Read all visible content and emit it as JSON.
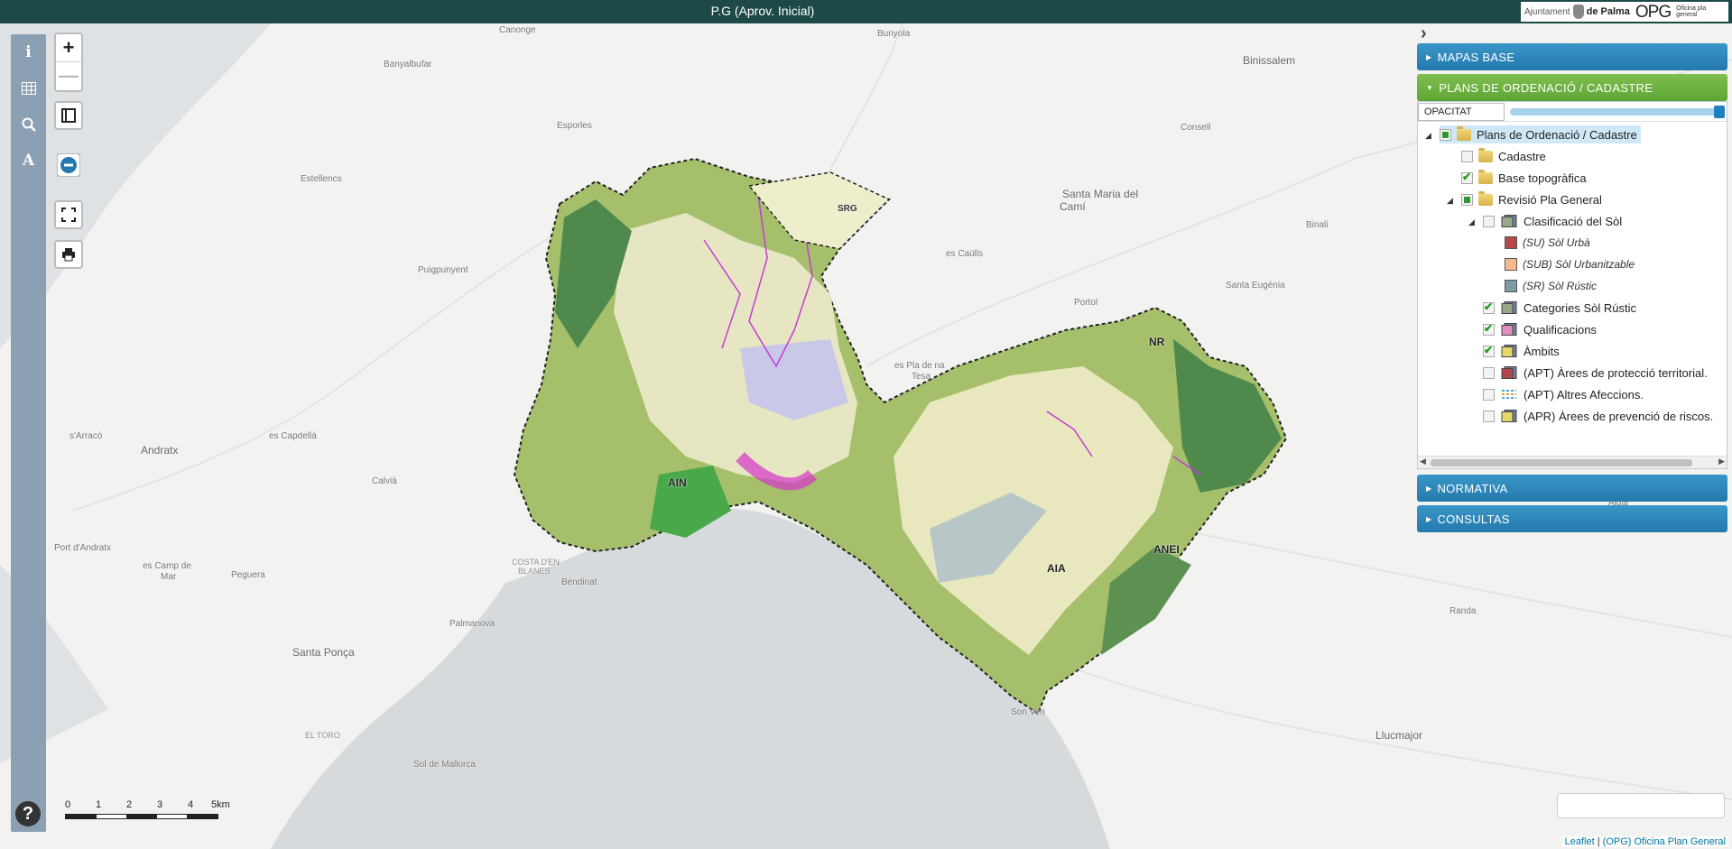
{
  "app": {
    "title": "P.G (Aprov. Inicial)"
  },
  "logos": {
    "ajuntament_prefix": "Ajuntament",
    "ajuntament_name": "de Palma",
    "opg": "OPG",
    "opg_sub": "Oficina pla general"
  },
  "rail": {
    "info_icon": "i",
    "table_icon": "table-icon",
    "search_icon": "search-icon",
    "text_icon": "A",
    "help_icon": "?"
  },
  "map_controls": {
    "zoom_in": "+",
    "zoom_out": "—"
  },
  "scale": {
    "labels": [
      "0",
      "1",
      "2",
      "3",
      "4",
      "5km"
    ]
  },
  "attribution": {
    "leaflet": "Leaflet",
    "separator": " | ",
    "opg": "(OPG) Oficina Plan General"
  },
  "places": [
    {
      "name": "Canonge",
      "cls": ""
    },
    {
      "name": "Bunyola",
      "cls": ""
    },
    {
      "name": "Banyalbufar",
      "cls": ""
    },
    {
      "name": "Binissalem",
      "cls": "big"
    },
    {
      "name": "Esporles",
      "cls": ""
    },
    {
      "name": "Consell",
      "cls": ""
    },
    {
      "name": "Estellencs",
      "cls": ""
    },
    {
      "name": "Santa Maria del",
      "cls": "big"
    },
    {
      "name": "Camí",
      "cls": "big"
    },
    {
      "name": "Binali",
      "cls": ""
    },
    {
      "name": "Puigpunyent",
      "cls": ""
    },
    {
      "name": "es Caülls",
      "cls": ""
    },
    {
      "name": "Santa Eugènia",
      "cls": ""
    },
    {
      "name": "Portol",
      "cls": ""
    },
    {
      "name": "es Pla de na",
      "cls": ""
    },
    {
      "name": "Tesa",
      "cls": ""
    },
    {
      "name": "s'Arracó",
      "cls": ""
    },
    {
      "name": "Andratx",
      "cls": "big"
    },
    {
      "name": "es Capdellà",
      "cls": ""
    },
    {
      "name": "Calvià",
      "cls": ""
    },
    {
      "name": "Algai",
      "cls": ""
    },
    {
      "name": "Port d'Andratx",
      "cls": ""
    },
    {
      "name": "es Camp de",
      "cls": ""
    },
    {
      "name": "Mar",
      "cls": ""
    },
    {
      "name": "Peguera",
      "cls": ""
    },
    {
      "name": "COSTA D'EN",
      "cls": "sea"
    },
    {
      "name": "BLANES",
      "cls": "sea"
    },
    {
      "name": "Bendinat",
      "cls": ""
    },
    {
      "name": "Palmanova",
      "cls": ""
    },
    {
      "name": "Santa Ponça",
      "cls": "big"
    },
    {
      "name": "Randa",
      "cls": ""
    },
    {
      "name": "Son Veri",
      "cls": ""
    },
    {
      "name": "Llucmajor",
      "cls": "big"
    },
    {
      "name": "EL TORO",
      "cls": "sea"
    },
    {
      "name": "Sol de Mallorca",
      "cls": ""
    }
  ],
  "map_labels": {
    "srg": "SRG",
    "nr": "NR",
    "ain": "AIN",
    "anei": "ANEI",
    "aia": "AIA"
  },
  "panel": {
    "mapas_base": "MAPAS BASE",
    "plans": "PLANS DE ORDENACIÓ / CADASTRE",
    "opacity_label": "OPACITAT",
    "opacity_value": 1.0,
    "normativa": "NORMATIVA",
    "consultas": "CONSULTAS"
  },
  "tree": [
    {
      "label": "Plans de Ordenació / Cadastre",
      "check": "partial",
      "icon": "folder",
      "sel": true
    },
    {
      "label": "Cadastre",
      "check": "none",
      "icon": "folder"
    },
    {
      "label": "Base topogràfica",
      "check": "checked",
      "icon": "folder"
    },
    {
      "label": "Revisió Pla General",
      "check": "partial",
      "icon": "folder"
    },
    {
      "label": "Clasificació del Sòl",
      "check": "none",
      "icon": "layer"
    },
    {
      "label": "(SU) Sòl Urbà",
      "swatch": "#b3474c"
    },
    {
      "label": "(SUB) Sòl Urbanitzable",
      "swatch": "#f7b98c"
    },
    {
      "label": "(SR) Sòl Rústic",
      "swatch": "#7e9aa6"
    },
    {
      "label": "Categories Sòl Rústic",
      "check": "checked",
      "icon": "layer"
    },
    {
      "label": "Qualificacions",
      "check": "checked",
      "icon": "layer-pink"
    },
    {
      "label": "Àmbits",
      "check": "checked",
      "icon": "layer-yellow"
    },
    {
      "label": "(APT) Àrees de protecció territorial.",
      "check": "none",
      "icon": "layer-red"
    },
    {
      "label": "(APT) Altres Afeccions.",
      "check": "none",
      "icon": "layer-lines"
    },
    {
      "label": "(APR) Àrees de prevenció de riscos.",
      "check": "none",
      "icon": "layer-yellow"
    }
  ]
}
